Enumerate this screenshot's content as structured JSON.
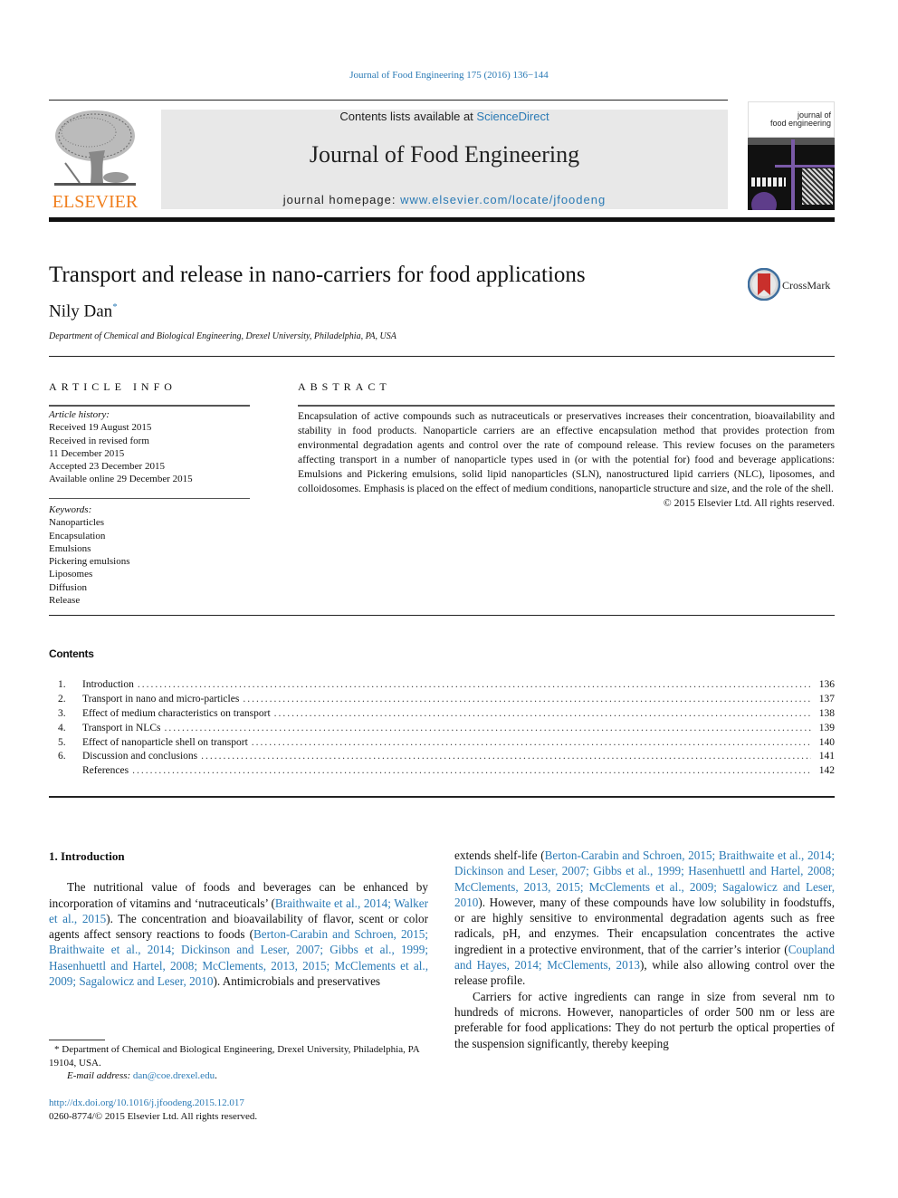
{
  "running_head": "Journal of Food Engineering 175 (2016) 136−144",
  "masthead": {
    "publisher_logo_text": "ELSEVIER",
    "contents_prefix": "Contents lists available at ",
    "contents_link": "ScienceDirect",
    "journal_title": "Journal of Food Engineering",
    "homepage_prefix": "journal homepage: ",
    "homepage_link": "www.elsevier.com/locate/jfoodeng",
    "cover_title_line1": "journal of",
    "cover_title_line2": "food engineering"
  },
  "article": {
    "title": "Transport and release in nano-carriers for food applications",
    "crossmark_label": "CrossMark",
    "author": "Nily Dan",
    "author_mark": "*",
    "affiliation": "Department of Chemical and Biological Engineering, Drexel University, Philadelphia, PA, USA"
  },
  "article_info": {
    "heading": "ARTICLE INFO",
    "history_label": "Article history:",
    "history": [
      "Received 19 August 2015",
      "Received in revised form",
      "11 December 2015",
      "Accepted 23 December 2015",
      "Available online 29 December 2015"
    ],
    "keywords_label": "Keywords:",
    "keywords": [
      "Nanoparticles",
      "Encapsulation",
      "Emulsions",
      "Pickering emulsions",
      "Liposomes",
      "Diffusion",
      "Release"
    ]
  },
  "abstract": {
    "heading": "ABSTRACT",
    "text": "Encapsulation of active compounds such as nutraceuticals or preservatives increases their concentration, bioavailability and stability in food products. Nanoparticle carriers are an effective encapsulation method that provides protection from environmental degradation agents and control over the rate of compound release. This review focuses on the parameters affecting transport in a number of nanoparticle types used in (or with the potential for) food and beverage applications: Emulsions and Pickering emulsions, solid lipid nanoparticles (SLN), nanostructured lipid carriers (NLC), liposomes, and colloidosomes. Emphasis is placed on the effect of medium conditions, nanoparticle structure and size, and the role of the shell.",
    "copyright": "© 2015 Elsevier Ltd. All rights reserved."
  },
  "contents": {
    "heading": "Contents",
    "items": [
      {
        "num": "1.",
        "title": "Introduction",
        "page": "136"
      },
      {
        "num": "2.",
        "title": "Transport in nano and micro-particles",
        "page": "137"
      },
      {
        "num": "3.",
        "title": "Effect of medium characteristics on transport",
        "page": "138"
      },
      {
        "num": "4.",
        "title": "Transport in NLCs",
        "page": "139"
      },
      {
        "num": "5.",
        "title": "Effect of nanoparticle shell on transport",
        "page": "140"
      },
      {
        "num": "6.",
        "title": "Discussion and conclusions",
        "page": "141"
      },
      {
        "num": "",
        "title": "References",
        "page": "142"
      }
    ]
  },
  "body": {
    "intro_heading": "1.  Introduction",
    "left_col": {
      "p1_t1": "The nutritional value of foods and beverages can be enhanced by incorporation of vitamins and ‘nutraceuticals’ (",
      "p1_c1": "Braithwaite et al., 2014; Walker et al., 2015",
      "p1_t2": "). The concentration and bioavailability of flavor, scent or color agents affect sensory reactions to foods (",
      "p1_c2": "Berton-Carabin and Schroen, 2015; Braithwaite et al., 2014; Dickinson and Leser, 2007; Gibbs et al., 1999; Hasenhuettl and Hartel, 2008; McClements, 2013, 2015; McClements et al., 2009; Sagalowicz and Leser, 2010",
      "p1_t3": "). Antimicrobials and preservatives"
    },
    "right_col": {
      "p1_t1": "extends shelf-life (",
      "p1_c1": "Berton-Carabin and Schroen, 2015; Braithwaite et al., 2014; Dickinson and Leser, 2007; Gibbs et al., 1999; Hasenhuettl and Hartel, 2008; McClements, 2013, 2015; McClements et al., 2009; Sagalowicz and Leser, 2010",
      "p1_t2": "). However, many of these compounds have low solubility in foodstuffs, or are highly sensitive to environmental degradation agents such as free radicals, pH, and enzymes. Their encapsulation concentrates the active ingredient in a protective environment, that of the carrier’s interior (",
      "p1_c2": "Coupland and Hayes, 2014; McClements, 2013",
      "p1_t3": "), while also allowing control over the release profile.",
      "p2": "Carriers for active ingredients can range in size from several nm to hundreds of microns. However, nanoparticles of order 500 nm or less are preferable for food applications: They do not perturb the optical properties of the suspension significantly, thereby keeping"
    }
  },
  "footnote": {
    "mark": "*",
    "address": " Department of Chemical and Biological Engineering, Drexel University, Philadelphia, PA 19104, USA.",
    "email_label": "E-mail address: ",
    "email": "dan@coe.drexel.edu",
    "email_suffix": "."
  },
  "doi": {
    "link": "http://dx.doi.org/10.1016/j.jfoodeng.2015.12.017",
    "issn_copyright": "0260-8774/© 2015 Elsevier Ltd. All rights reserved."
  },
  "colors": {
    "link": "#2a7ab5",
    "elsevier_orange": "#f07f1e",
    "banner_bg": "#e8e8e8"
  }
}
